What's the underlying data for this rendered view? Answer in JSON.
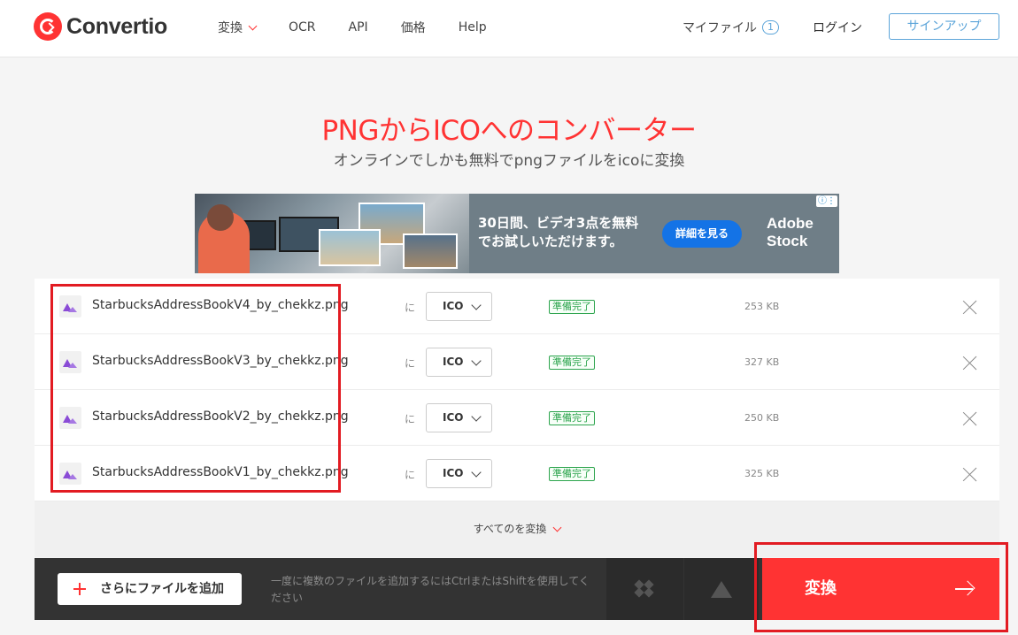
{
  "brand": {
    "name": "Convertio"
  },
  "nav": [
    {
      "label": "変換",
      "has_dropdown": true
    },
    {
      "label": "OCR"
    },
    {
      "label": "API"
    },
    {
      "label": "価格"
    },
    {
      "label": "Help"
    }
  ],
  "header": {
    "my_files": "マイファイル",
    "my_files_count": "1",
    "login": "ログイン",
    "signup": "サインアップ"
  },
  "hero": {
    "title": "PNGからICOへのコンバーター",
    "subtitle": "オンラインでしかも無料でpngファイルをicoに変換"
  },
  "ad": {
    "text_line1": "30日間、ビデオ3点を無料",
    "text_line2": "でお試しいただけます。",
    "button": "詳細を見る",
    "brand_line1": "Adobe",
    "brand_line2": "Stock",
    "info_icon": "info-icon"
  },
  "files": [
    {
      "name": "StarbucksAddressBookV4_by_chekkz.png",
      "to": "に",
      "format": "ICO",
      "status": "準備完了",
      "size": "253 KB"
    },
    {
      "name": "StarbucksAddressBookV3_by_chekkz.png",
      "to": "に",
      "format": "ICO",
      "status": "準備完了",
      "size": "327 KB"
    },
    {
      "name": "StarbucksAddressBookV2_by_chekkz.png",
      "to": "に",
      "format": "ICO",
      "status": "準備完了",
      "size": "250 KB"
    },
    {
      "name": "StarbucksAddressBookV1_by_chekkz.png",
      "to": "に",
      "format": "ICO",
      "status": "準備完了",
      "size": "325 KB"
    }
  ],
  "convert_all": "すべてのを変換",
  "bottom": {
    "add_files": "さらにファイルを追加",
    "hint": "一度に複数のファイルを追加するにはCtrlまたはShiftを使用してください",
    "convert": "変換"
  },
  "colors": {
    "accent": "#ff3333",
    "status_green": "#2ca44d",
    "link_blue": "#5ba4d9",
    "bar_dark": "#333333"
  }
}
